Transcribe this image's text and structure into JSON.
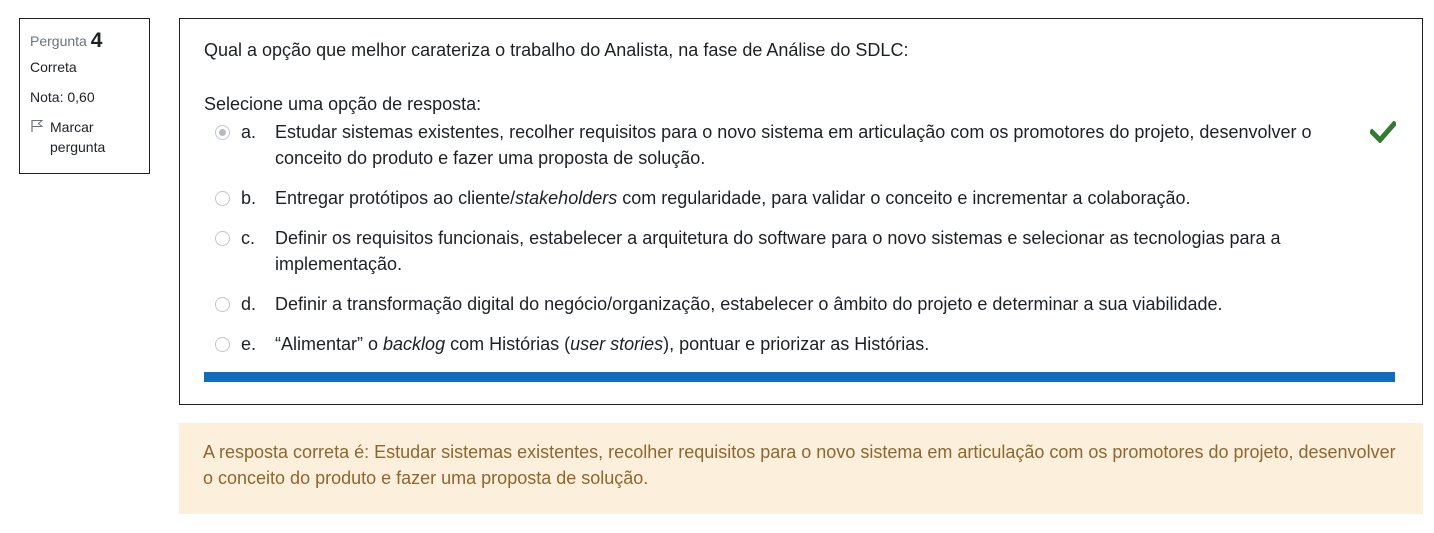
{
  "info": {
    "question_label": "Pergunta",
    "question_number": "4",
    "state": "Correta",
    "grade": "Nota: 0,60",
    "flag_label": "Marcar pergunta"
  },
  "question": {
    "text": "Qual a opção que melhor carateriza o trabalho do Analista, na fase de Análise do SDLC:",
    "prompt": "Selecione uma opção de resposta:"
  },
  "options": [
    {
      "letter": "a.",
      "parts": [
        "Estudar sistemas existentes, recolher requisitos para o novo sistema em articulação com os promotores do projeto, desenvolver o conceito do produto e fazer uma proposta de solução."
      ],
      "selected": true,
      "correct": true
    },
    {
      "letter": "b.",
      "parts": [
        "Entregar protótipos ao cliente/",
        "stakeholders",
        " com regularidade, para validar o conceito e incrementar a colaboração."
      ],
      "selected": false
    },
    {
      "letter": "c.",
      "parts": [
        "Definir os requisitos funcionais, estabelecer a arquitetura do software para o novo sistemas e selecionar as tecnologias para a implementação."
      ],
      "selected": false
    },
    {
      "letter": "d.",
      "parts": [
        "Definir a transformação digital do negócio/organização, estabelecer o âmbito do projeto e determinar a sua viabilidade."
      ],
      "selected": false
    },
    {
      "letter": "e.",
      "parts": [
        "“Alimentar” o ",
        "backlog",
        " com Histórias (",
        "user stories",
        "), pontuar e priorizar as Histórias."
      ],
      "selected": false
    }
  ],
  "progress": {
    "fraction": 1.0
  },
  "feedback": {
    "right_answer": "A resposta correta é: Estudar sistemas existentes, recolher requisitos para o novo sistema em articulação com os promotores do projeto, desenvolver o conceito do produto e fazer uma proposta de solução."
  },
  "colors": {
    "accent": "#0f6cbf",
    "correct_check": "#357a32",
    "feedback_bg": "#fcefdc",
    "feedback_text": "#8e662e"
  }
}
